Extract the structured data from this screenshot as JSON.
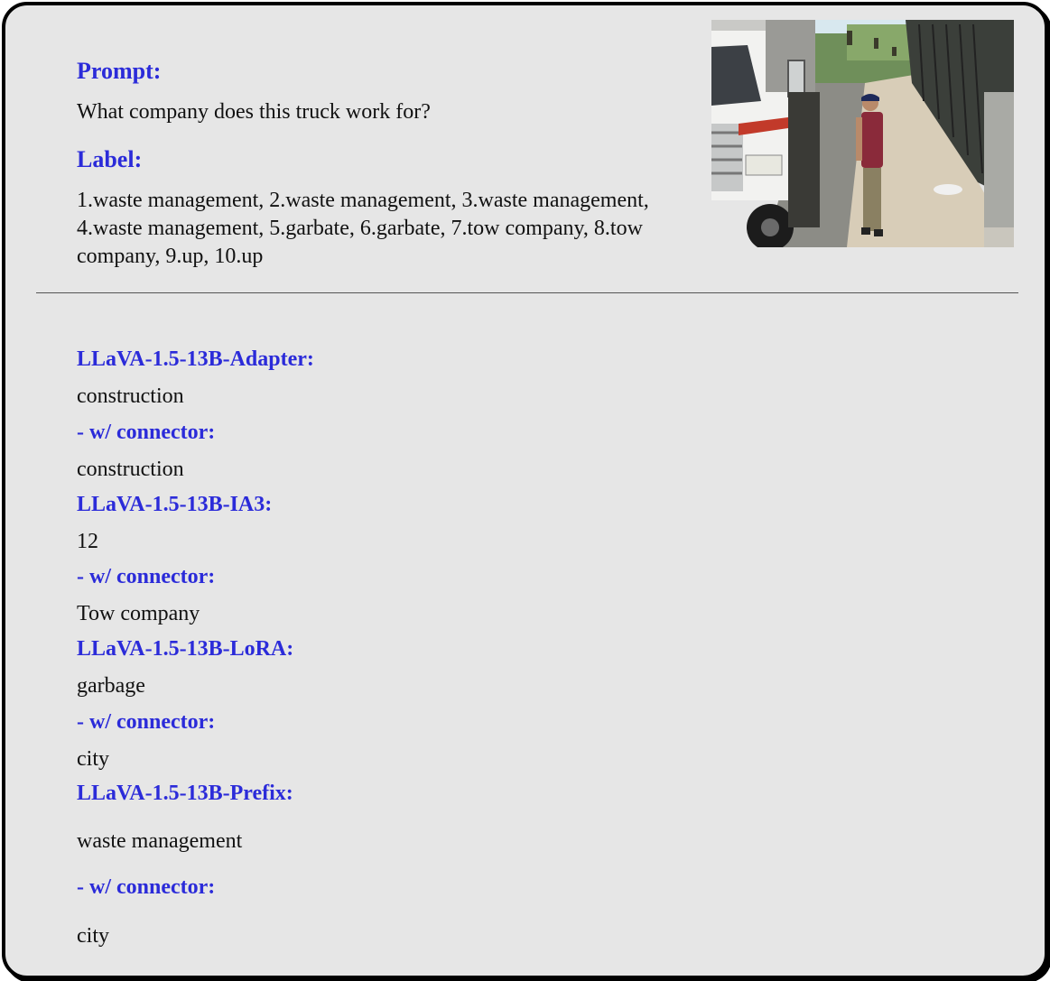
{
  "prompt": {
    "heading": "Prompt:",
    "text": "What company does this truck work for?"
  },
  "label": {
    "heading": "Label:",
    "text": "1.waste management, 2.waste management, 3.waste management, 4.waste management, 5.garbate, 6.garbate, 7.tow company, 8.tow company, 9.up, 10.up"
  },
  "results": [
    {
      "heading": "LLaVA-1.5-13B-Adapter:",
      "answer": "construction"
    },
    {
      "heading": "- w/ connector:",
      "answer": "construction"
    },
    {
      "heading": "LLaVA-1.5-13B-IA3:",
      "answer": "12"
    },
    {
      "heading": "- w/ connector:",
      "answer": "Tow company"
    },
    {
      "heading": "LLaVA-1.5-13B-LoRA:",
      "answer": "garbage"
    },
    {
      "heading": "- w/ connector:",
      "answer": "city"
    },
    {
      "heading": "LLaVA-1.5-13B-Prefix:",
      "answer": "waste management"
    },
    {
      "heading": "- w/ connector:",
      "answer": "city"
    }
  ],
  "colors": {
    "heading": "#2b2bd9",
    "background": "#e6e6e6",
    "border": "#000000"
  }
}
